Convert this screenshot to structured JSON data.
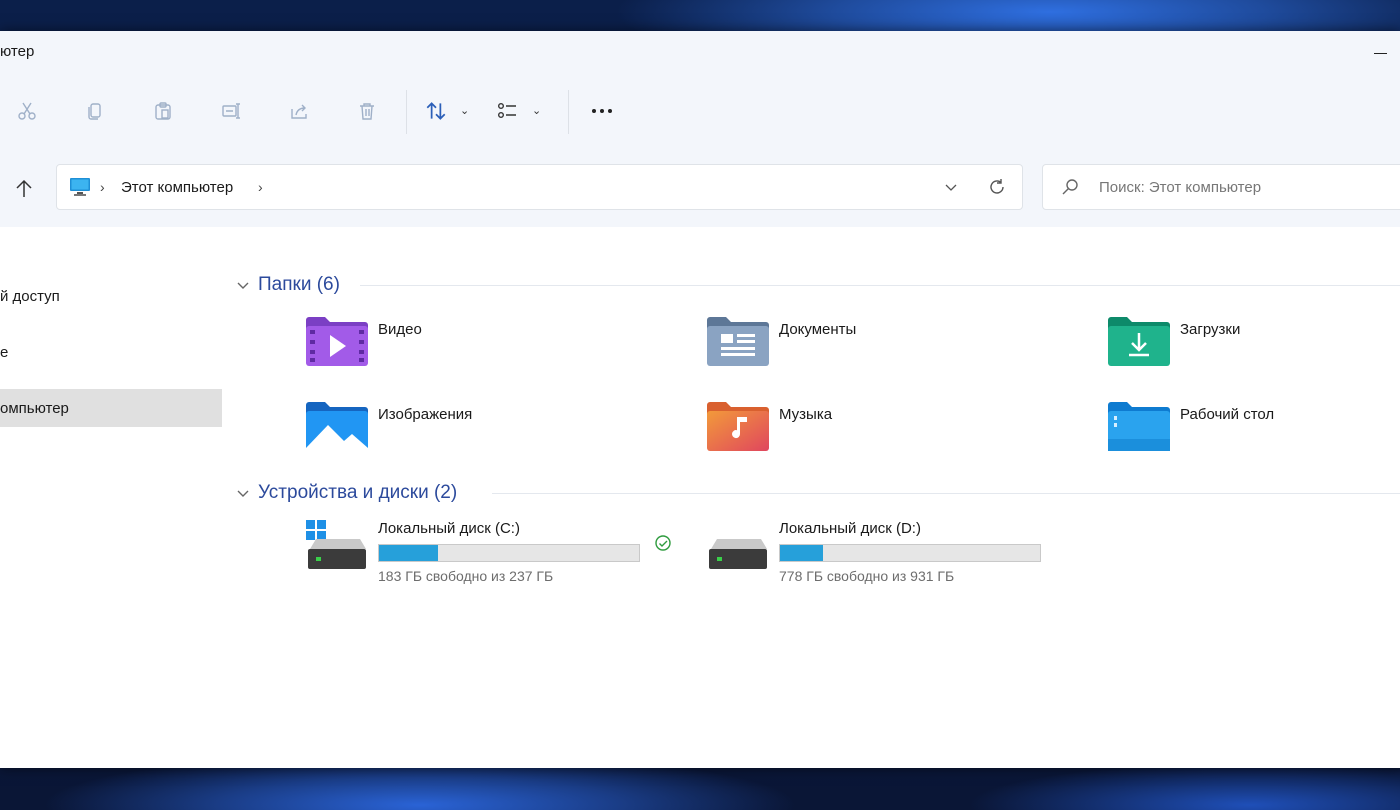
{
  "window": {
    "title": "ютер"
  },
  "toolbar": {
    "icons": [
      "cut-icon",
      "copy-icon",
      "paste-icon",
      "rename-icon",
      "share-icon",
      "delete-icon",
      "sort-icon",
      "view-icon",
      "more-icon"
    ]
  },
  "address": {
    "path_label": "Этот компьютер",
    "separator": "›",
    "search_placeholder": "Поиск: Этот компьютер"
  },
  "sidebar": {
    "items": [
      {
        "label": "й доступ"
      },
      {
        "label": "е"
      },
      {
        "label": "омпьютер",
        "selected": true
      }
    ]
  },
  "groups": {
    "folders_title": "Папки (6)",
    "drives_title": "Устройства и диски (2)"
  },
  "folders": [
    {
      "name": "Видео",
      "icon": "video-folder-icon"
    },
    {
      "name": "Документы",
      "icon": "documents-folder-icon"
    },
    {
      "name": "Загрузки",
      "icon": "downloads-folder-icon"
    },
    {
      "name": "Изображения",
      "icon": "pictures-folder-icon"
    },
    {
      "name": "Музыка",
      "icon": "music-folder-icon"
    },
    {
      "name": "Рабочий стол",
      "icon": "desktop-folder-icon"
    }
  ],
  "drives": [
    {
      "name": "Локальный диск (C:)",
      "free_text": "183 ГБ свободно из 237 ГБ",
      "used_fraction": 0.228,
      "icon": "system-drive-icon"
    },
    {
      "name": "Локальный диск (D:)",
      "free_text": "778 ГБ свободно из 931 ГБ",
      "used_fraction": 0.164,
      "icon": "drive-icon"
    }
  ],
  "colors": {
    "accent": "#26a0da",
    "group_header": "#2c4a9c",
    "toolbar_bg": "#f3f6fb",
    "selected_sidebar": "#e0e0e0"
  }
}
